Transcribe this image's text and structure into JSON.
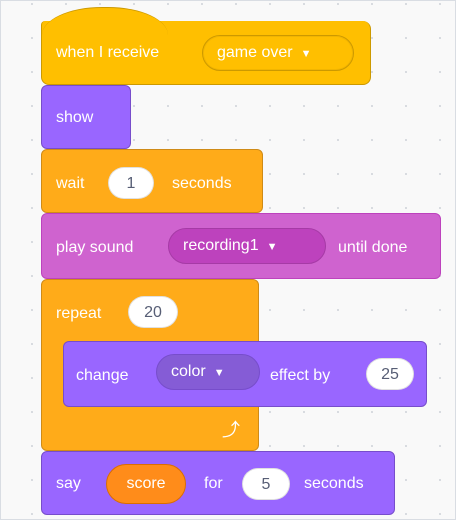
{
  "blocks": {
    "when_receive": {
      "label": "when I receive",
      "message": "game over"
    },
    "show": {
      "label": "show"
    },
    "wait": {
      "label": "wait",
      "value": "1",
      "suffix": "seconds"
    },
    "play_sound": {
      "label": "play sound",
      "sound": "recording1",
      "suffix": "until done"
    },
    "repeat": {
      "label": "repeat",
      "value": "20"
    },
    "change_effect": {
      "label": "change",
      "effect": "color",
      "middle": "effect by",
      "value": "25"
    },
    "say": {
      "label": "say",
      "reporter": "score",
      "middle": "for",
      "value": "5",
      "suffix": "seconds"
    }
  },
  "icons": {
    "dropdown": "triangle-down-icon",
    "loop": "loop-arrow-icon"
  },
  "colors": {
    "events": "#ffbf00",
    "looks": "#9966ff",
    "control": "#ffab19",
    "sound": "#cf63cf",
    "operator_reporter": "#ff8c1a"
  }
}
